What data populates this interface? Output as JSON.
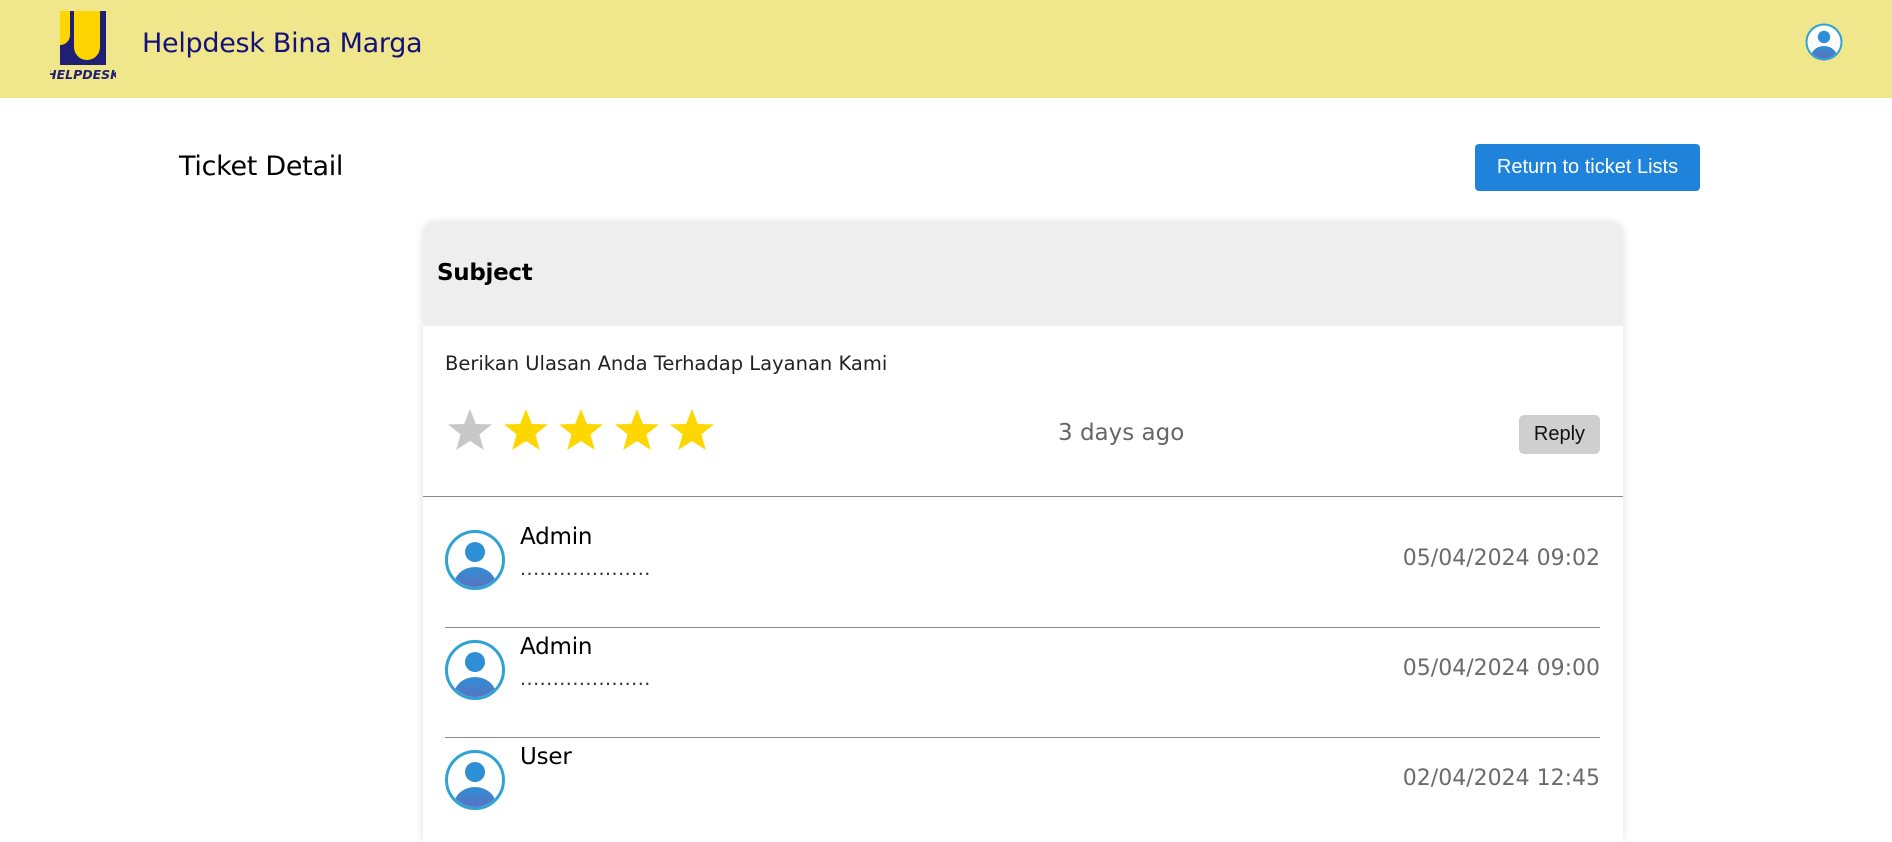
{
  "header": {
    "app_title": "Helpdesk Bina Marga",
    "logo_text": "HELPDESK",
    "profile_icon": "user-avatar-icon",
    "colors": {
      "bar": "#f0e68c",
      "title": "#13127a"
    }
  },
  "page": {
    "title": "Ticket Detail",
    "return_button_label": "Return to ticket Lists",
    "colors": {
      "primary": "#1f83dc"
    }
  },
  "ticket": {
    "subject_label": "Subject",
    "feedback_prompt": "Berikan Ulasan Anda Terhadap Layanan Kami",
    "rating": {
      "filled": 4,
      "max": 5,
      "filled_color": "#ffd700",
      "empty_color": "#c8c8c8",
      "icon": "star-icon"
    },
    "relative_time": "3 days ago",
    "reply_button_label": "Reply"
  },
  "messages": [
    {
      "author": "Admin",
      "body": "....................",
      "timestamp": "05/04/2024 09:02"
    },
    {
      "author": "Admin",
      "body": "....................",
      "timestamp": "05/04/2024 09:00"
    },
    {
      "author": "User",
      "body": "",
      "timestamp": "02/04/2024 12:45"
    }
  ]
}
